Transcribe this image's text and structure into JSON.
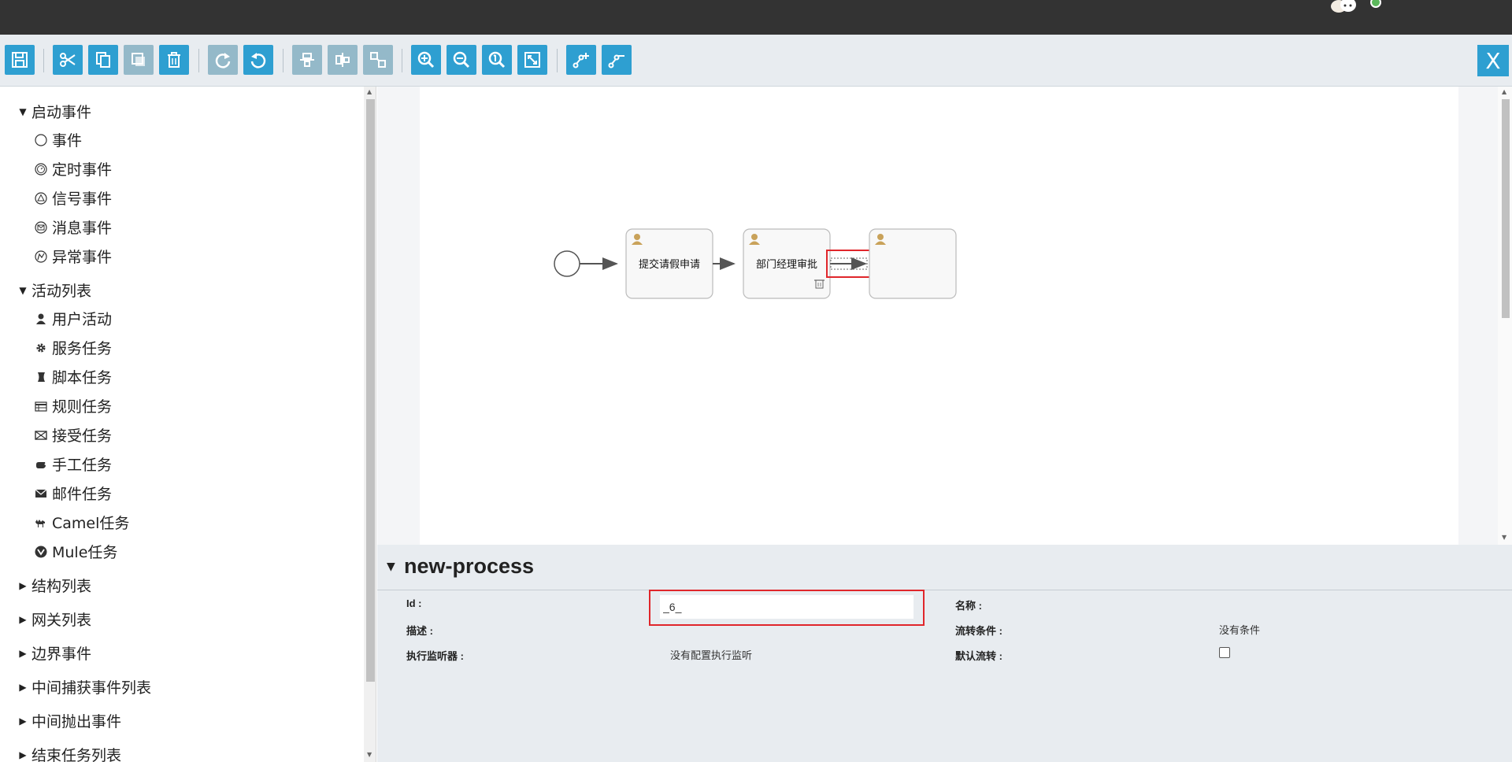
{
  "topbar": {
    "avatar_icon": "user-avatar-icon",
    "status_color": "#5cb85c"
  },
  "toolbar": {
    "buttons": [
      {
        "name": "save",
        "icon": "save-icon"
      },
      {
        "name": "cut",
        "icon": "scissors-icon"
      },
      {
        "name": "copy",
        "icon": "copy-icon"
      },
      {
        "name": "paste",
        "icon": "paste-icon"
      },
      {
        "name": "delete",
        "icon": "trash-icon"
      },
      {
        "name": "redo",
        "icon": "redo-icon"
      },
      {
        "name": "undo",
        "icon": "undo-icon"
      },
      {
        "name": "align-horizontal",
        "icon": "align-horizontal-icon"
      },
      {
        "name": "align-vertical",
        "icon": "align-vertical-icon"
      },
      {
        "name": "same-size",
        "icon": "same-size-icon"
      },
      {
        "name": "zoom-in",
        "icon": "zoom-in-icon"
      },
      {
        "name": "zoom-out",
        "icon": "zoom-out-icon"
      },
      {
        "name": "zoom-actual",
        "icon": "zoom-actual-icon"
      },
      {
        "name": "zoom-fit",
        "icon": "zoom-fit-icon"
      },
      {
        "name": "add-bendpoint",
        "icon": "add-bendpoint-icon"
      },
      {
        "name": "remove-bendpoint",
        "icon": "remove-bendpoint-icon"
      }
    ],
    "close_label": "X",
    "accent": "#2e9fd1"
  },
  "palette": {
    "groups": [
      {
        "label": "启动事件",
        "items": [
          "事件",
          "定时事件",
          "信号事件",
          "消息事件",
          "异常事件"
        ]
      },
      {
        "label": "活动列表",
        "items": [
          "用户活动",
          "服务任务",
          "脚本任务",
          "规则任务",
          "接受任务",
          "手工任务",
          "邮件任务",
          "Camel任务",
          "Mule任务"
        ]
      },
      {
        "label": "结构列表"
      },
      {
        "label": "网关列表"
      },
      {
        "label": "边界事件"
      },
      {
        "label": "中间捕获事件列表"
      },
      {
        "label": "中间抛出事件"
      },
      {
        "label": "结束任务列表"
      }
    ]
  },
  "diagram": {
    "tasks": [
      {
        "label": "提交请假申请"
      },
      {
        "label": "部门经理审批"
      },
      {
        "label": ""
      }
    ],
    "highlight_color": "#e0262b"
  },
  "properties": {
    "title": "new-process",
    "id_label": "Id :",
    "id_value": "_6_",
    "name_label": "名称 :",
    "desc_label": "描述 :",
    "condition_label": "流转条件 :",
    "condition_value": "没有条件",
    "listener_label": "执行监听器 :",
    "listener_value": "没有配置执行监听",
    "default_flow_label": "默认流转 :",
    "default_flow_checked": false
  }
}
